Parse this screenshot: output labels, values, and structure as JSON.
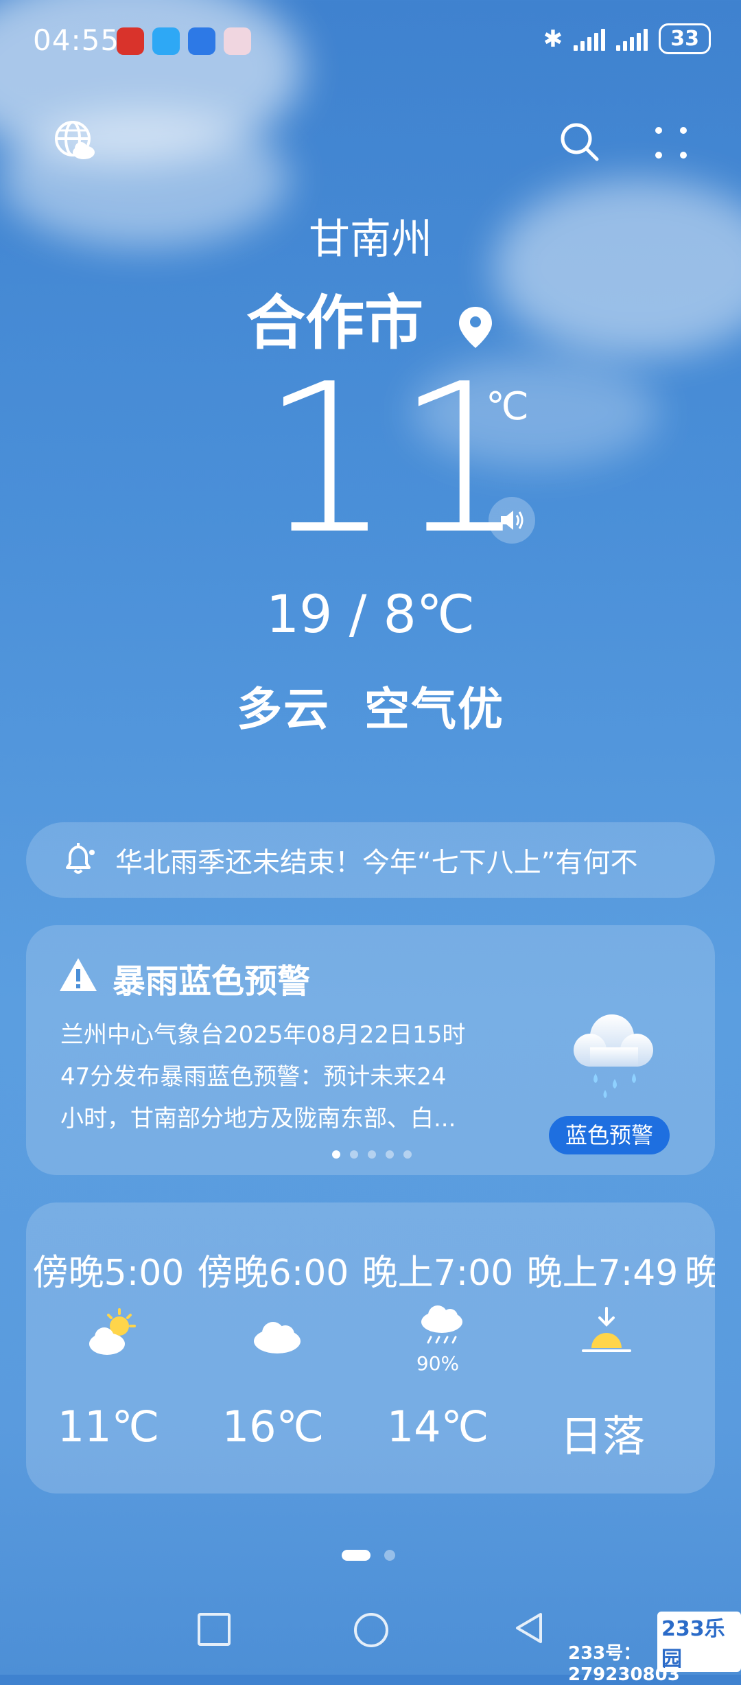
{
  "status_bar": {
    "time": "04:55",
    "battery": "33",
    "bluetooth_icon": "bluetooth-icon"
  },
  "header": {
    "region": "甘南州",
    "city": "合作市",
    "left_icon": "globe-cloud-icon",
    "search_icon": "search-icon",
    "more_icon": "dots-grid-icon"
  },
  "current": {
    "temperature": "11",
    "unit": "℃",
    "range": "19 / 8℃",
    "condition": "多云  空气优"
  },
  "news": {
    "text": "华北雨季还未结束！今年“七下八上”有何不"
  },
  "warning": {
    "title": "暴雨蓝色预警",
    "body_lines": [
      "兰州中心气象台2025年08月22日15时",
      "47分发布暴雨蓝色预警：预计未来24",
      "小时，甘南部分地方及陇南东部、白..."
    ],
    "badge": "蓝色预警",
    "badge_color": "#1e6fe0",
    "page_count": 5,
    "active_page": 1
  },
  "hourly": [
    {
      "time": "傍晚5:00",
      "icon": "partly-cloudy-sun-icon",
      "pop": "",
      "temp": "11℃"
    },
    {
      "time": "傍晚6:00",
      "icon": "cloud-icon",
      "pop": "",
      "temp": "16℃"
    },
    {
      "time": "晚上7:00",
      "icon": "rain-cloud-icon",
      "pop": "90%",
      "temp": "14℃"
    },
    {
      "time": "晚上7:49",
      "icon": "sunset-icon",
      "pop": "",
      "temp": "日落"
    },
    {
      "time": "晚",
      "icon": "",
      "pop": "",
      "temp": ""
    }
  ],
  "watermark": {
    "logo": "233乐园",
    "text": "233号：279230803"
  }
}
